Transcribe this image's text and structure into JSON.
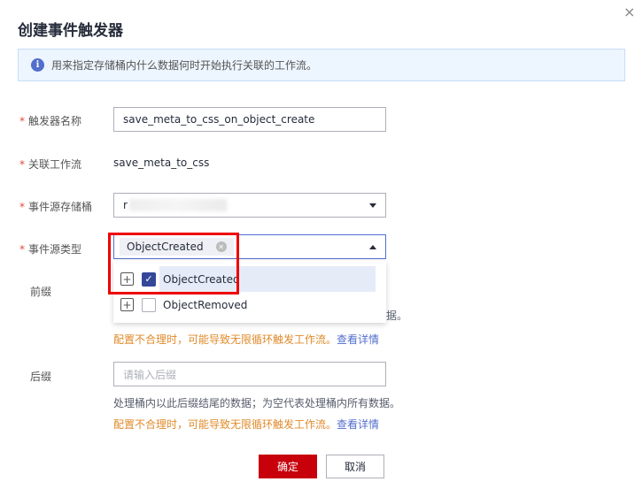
{
  "dialog": {
    "title": "创建事件触发器",
    "close": "×",
    "info": "用来指定存储桶内什么数据何时开始执行关联的工作流。"
  },
  "form": {
    "required_mark": "*",
    "trigger_name": {
      "label": "触发器名称",
      "value": "save_meta_to_css_on_object_create"
    },
    "workflow": {
      "label": "关联工作流",
      "value": "save_meta_to_css"
    },
    "bucket": {
      "label": "事件源存储桶",
      "value": "r"
    },
    "event_type": {
      "label": "事件源类型",
      "tag": "ObjectCreated",
      "options": [
        {
          "label": "ObjectCreated",
          "checked": true
        },
        {
          "label": "ObjectRemoved",
          "checked": false
        }
      ]
    },
    "prefix": {
      "label": "前缀",
      "hint_tail": "据。",
      "warn": "配置不合理时，可能导致无限循环触发工作流。",
      "link": "查看详情"
    },
    "suffix": {
      "label": "后缀",
      "placeholder": "请输入后缀",
      "hint": "处理桶内以此后缀结尾的数据；为空代表处理桶内所有数据。",
      "warn": "配置不合理时，可能导致无限循环触发工作流。",
      "link": "查看详情"
    }
  },
  "buttons": {
    "ok": "确定",
    "cancel": "取消"
  }
}
